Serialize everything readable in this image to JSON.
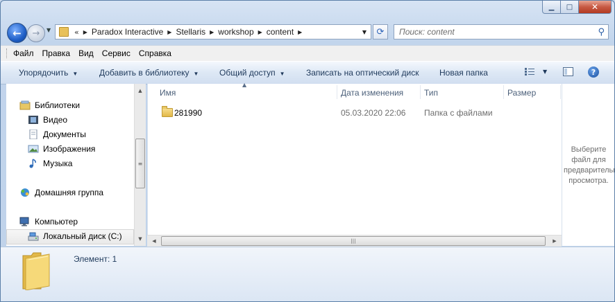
{
  "window": {
    "caption_buttons": {
      "minimize": "▁",
      "maximize": "□",
      "close": "✕"
    }
  },
  "nav": {
    "back_glyph": "←",
    "forward_glyph": "→",
    "address": {
      "overflow": "«",
      "crumbs": [
        "Paradox Interactive",
        "Stellaris",
        "workshop",
        "content"
      ]
    },
    "search": {
      "placeholder": "Поиск: content"
    }
  },
  "menu": {
    "items": [
      "Файл",
      "Правка",
      "Вид",
      "Сервис",
      "Справка"
    ]
  },
  "toolbar": {
    "organize": "Упорядочить",
    "add_to_library": "Добавить в библиотеку",
    "share": "Общий доступ",
    "burn": "Записать на оптический диск",
    "new_folder": "Новая папка"
  },
  "sidebar": {
    "libraries": "Библиотеки",
    "video": "Видео",
    "documents": "Документы",
    "images": "Изображения",
    "music": "Музыка",
    "homegroup": "Домашняя группа",
    "computer": "Компьютер",
    "local_disk": "Локальный диск (C:)"
  },
  "filelist": {
    "columns": {
      "name": "Имя",
      "date": "Дата изменения",
      "type": "Тип",
      "size": "Размер"
    },
    "rows": [
      {
        "name": "281990",
        "date": "05.03.2020 22:06",
        "type": "Папка с файлами",
        "size": ""
      }
    ]
  },
  "preview": {
    "message": "Выберите файл для предварительного просмотра."
  },
  "details": {
    "item_count": "Элемент: 1"
  },
  "colors": {
    "frame": "#c2d5ec",
    "accent": "#1e395b",
    "folder": "#e2b848"
  }
}
